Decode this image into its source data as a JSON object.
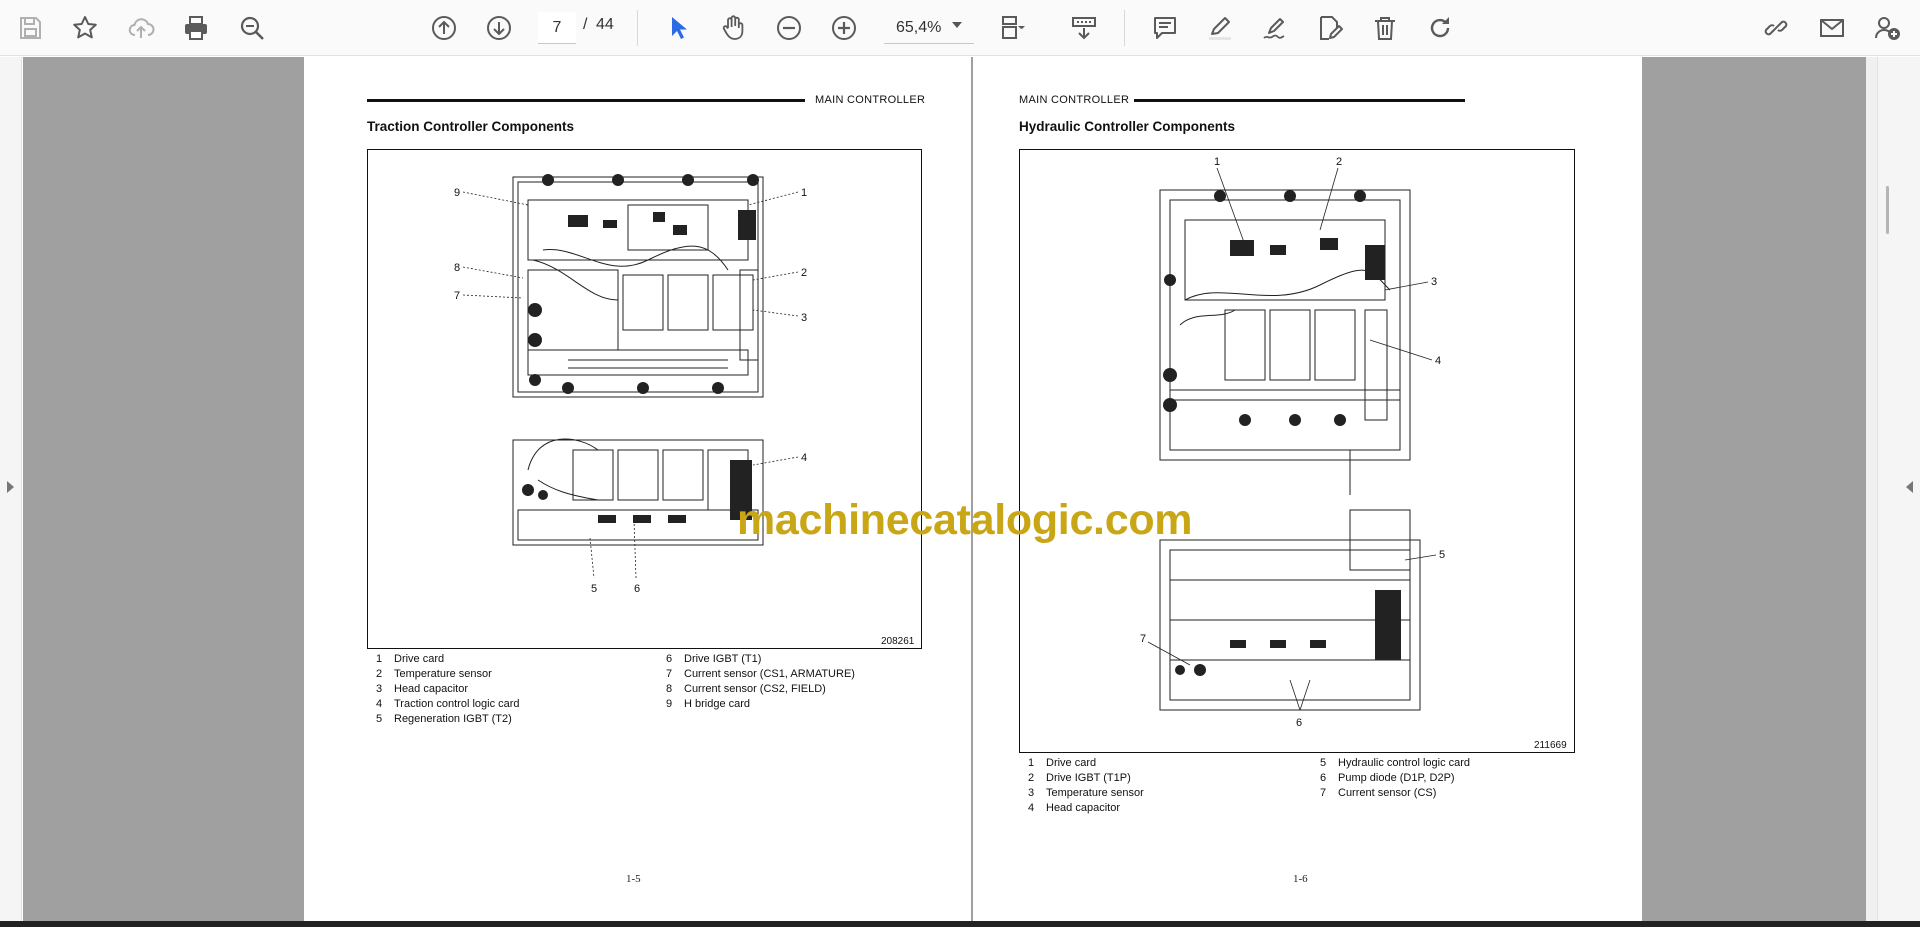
{
  "toolbar": {
    "current_page": "7",
    "separator": "/",
    "total_pages": "44",
    "zoom": "65,4%"
  },
  "left_page": {
    "header": "MAIN CONTROLLER",
    "title": "Traction Controller Components",
    "figure_number": "208261",
    "legend_col1": [
      {
        "n": "1",
        "text": "Drive card"
      },
      {
        "n": "2",
        "text": "Temperature sensor"
      },
      {
        "n": "3",
        "text": "Head capacitor"
      },
      {
        "n": "4",
        "text": "Traction control logic card"
      },
      {
        "n": "5",
        "text": "Regeneration IGBT (T2)"
      }
    ],
    "legend_col2": [
      {
        "n": "6",
        "text": "Drive IGBT (T1)"
      },
      {
        "n": "7",
        "text": "Current sensor (CS1, ARMATURE)"
      },
      {
        "n": "8",
        "text": "Current sensor (CS2, FIELD)"
      },
      {
        "n": "9",
        "text": "H bridge card"
      }
    ],
    "callouts": [
      "9",
      "8",
      "7",
      "1",
      "2",
      "3",
      "4",
      "5",
      "6"
    ],
    "page_number": "1-5"
  },
  "right_page": {
    "header": "MAIN CONTROLLER",
    "title": "Hydraulic Controller Components",
    "figure_number": "211669",
    "legend_col1": [
      {
        "n": "1",
        "text": "Drive card"
      },
      {
        "n": "2",
        "text": "Drive IGBT (T1P)"
      },
      {
        "n": "3",
        "text": "Temperature sensor"
      },
      {
        "n": "4",
        "text": "Head capacitor"
      }
    ],
    "legend_col2": [
      {
        "n": "5",
        "text": "Hydraulic control logic card"
      },
      {
        "n": "6",
        "text": "Pump diode (D1P, D2P)"
      },
      {
        "n": "7",
        "text": "Current sensor (CS)"
      }
    ],
    "callouts": [
      "1",
      "2",
      "3",
      "4",
      "5",
      "7",
      "6"
    ],
    "page_number": "1-6"
  },
  "watermark": "machinecatalogic.com",
  "colors": {
    "accent_blue": "#2d6be4",
    "icon_gray": "#5a5a5a",
    "watermark": "#c9a615",
    "canvas": "#a0a0a0"
  }
}
